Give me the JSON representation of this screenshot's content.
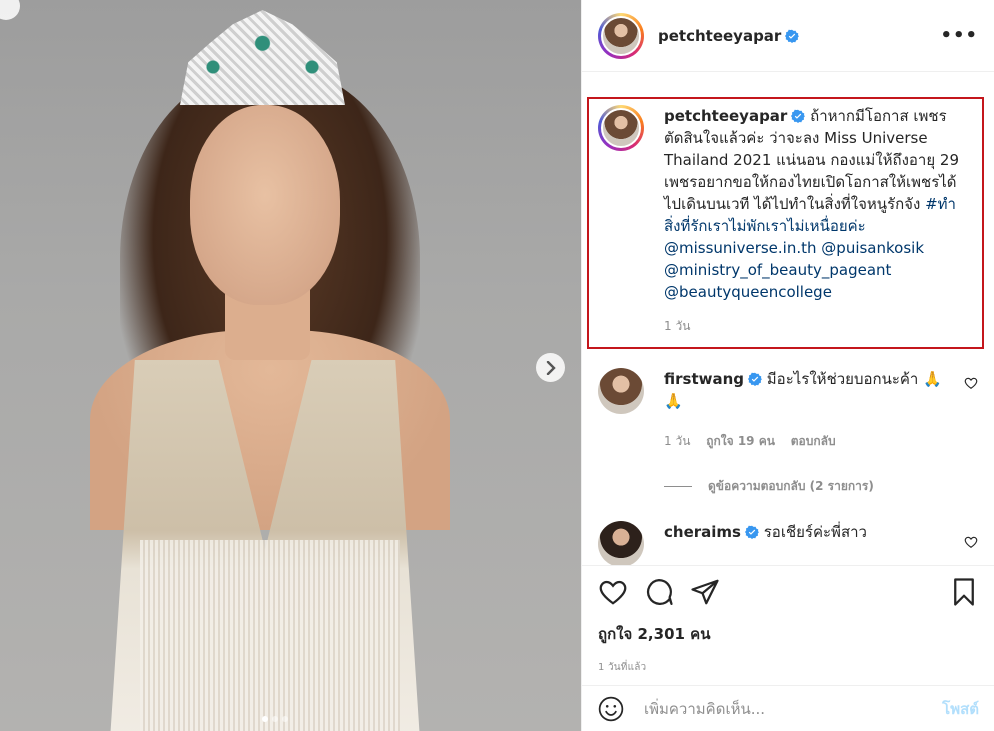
{
  "post": {
    "username": "petchteeyapar",
    "more_label": "•••"
  },
  "caption": {
    "username": "petchteeyapar",
    "text": "ถ้าหากมีโอกาส เพชรตัดสินใจแล้วค่ะ ว่าจะลง Miss Universe Thailand 2021 แน่นอน กองแม่ให้ถึงอายุ 29 เพชรอยากขอให้กองไทยเปิดโอกาสให้เพชรได้ไปเดินบนเวที ได้ไปทำในสิ่งที่ใจหนูรักจัง",
    "hashtag": "#ทำสิ่งที่รักเราไม่พักเราไม่เหนื่อยค่ะ",
    "mention1": "@missuniverse.in.th",
    "mention2": "@puisankosik",
    "mention3": "@ministry_of_beauty_pageant",
    "mention4": "@beautyqueencollege",
    "time": "1 วัน"
  },
  "comments": [
    {
      "username": "firstwang",
      "text": "มีอะไรให้ช่วยบอกนะค้า 🙏🙏",
      "time": "1 วัน",
      "likes": "ถูกใจ 19 คน",
      "reply": "ตอบกลับ",
      "view_replies": "ดูข้อความตอบกลับ (2 รายการ)"
    },
    {
      "username": "cheraims",
      "text": "รอเชียร์ค่ะพี่สาว"
    }
  ],
  "actions": {
    "likes": "ถูกใจ 2,301 คน",
    "time": "1 วันที่แล้ว"
  },
  "composer": {
    "placeholder": "เพิ่มความคิดเห็น...",
    "post_label": "โพสต์"
  },
  "carousel": {
    "slide_count": 3,
    "active_slide": 1
  },
  "colors": {
    "verified": "#3897f0",
    "link": "#00376b",
    "highlight_box": "#c4161c",
    "post_button": "#b2dffc"
  }
}
